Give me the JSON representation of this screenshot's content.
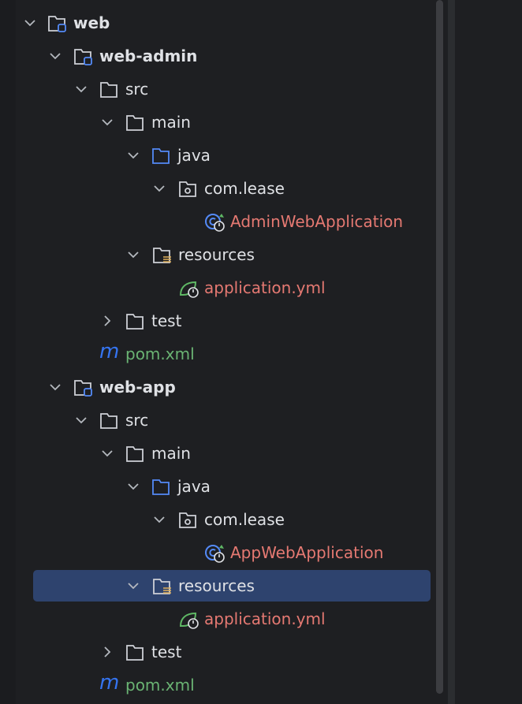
{
  "project_tree": {
    "nodes": [
      {
        "label": "web"
      },
      {
        "label": "web-admin"
      },
      {
        "label": "src"
      },
      {
        "label": "main"
      },
      {
        "label": "java"
      },
      {
        "label": "com.lease"
      },
      {
        "label": "AdminWebApplication"
      },
      {
        "label": "resources"
      },
      {
        "label": "application.yml"
      },
      {
        "label": "test"
      },
      {
        "label": "pom.xml"
      },
      {
        "label": "web-app"
      },
      {
        "label": "src"
      },
      {
        "label": "main"
      },
      {
        "label": "java"
      },
      {
        "label": "com.lease"
      },
      {
        "label": "AppWebApplication"
      },
      {
        "label": "resources"
      },
      {
        "label": "application.yml"
      },
      {
        "label": "test"
      },
      {
        "label": "pom.xml"
      }
    ]
  },
  "colors": {
    "background": "#1e1f22",
    "selection": "#2e436e",
    "text": "#dfe1e5",
    "modified_red": "#e57972",
    "added_green": "#6ab373",
    "java_folder_blue": "#548af7",
    "maven_blue": "#3574f0",
    "spring_green": "#5fb865"
  },
  "icons": [
    "chevron-down-icon",
    "chevron-right-icon",
    "module-folder-icon",
    "folder-icon",
    "source-folder-icon",
    "package-icon",
    "spring-boot-class-icon",
    "resources-folder-icon",
    "spring-config-icon",
    "maven-icon"
  ]
}
